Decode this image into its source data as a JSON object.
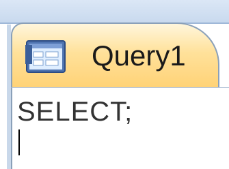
{
  "tab": {
    "title": "Query1",
    "icon": "query-datasheet-icon"
  },
  "editor": {
    "sql_text": "SELECT;"
  },
  "colors": {
    "tab_top": "#fff6dc",
    "tab_bottom": "#ffd276",
    "frame": "#8aa0b9",
    "titlebar": "#dbe7f6"
  }
}
